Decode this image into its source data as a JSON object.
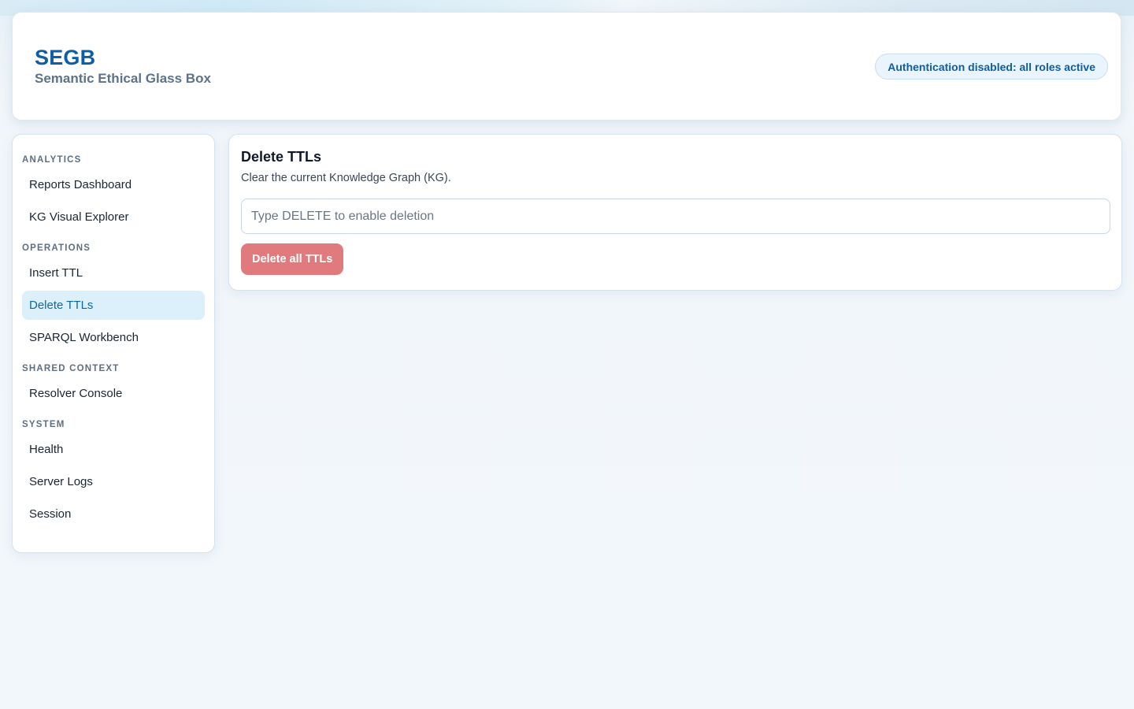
{
  "header": {
    "title": "SEGB",
    "subtitle": "Semantic Ethical Glass Box",
    "auth_badge": "Authentication disabled: all roles active"
  },
  "sidebar": {
    "sections": [
      {
        "title": "ANALYTICS",
        "items": [
          {
            "label": "Reports Dashboard"
          },
          {
            "label": "KG Visual Explorer"
          }
        ]
      },
      {
        "title": "OPERATIONS",
        "items": [
          {
            "label": "Insert TTL"
          },
          {
            "label": "Delete TTLs",
            "active": true
          },
          {
            "label": "SPARQL Workbench"
          }
        ]
      },
      {
        "title": "SHARED CONTEXT",
        "items": [
          {
            "label": "Resolver Console"
          }
        ]
      },
      {
        "title": "SYSTEM",
        "items": [
          {
            "label": "Health"
          },
          {
            "label": "Server Logs"
          },
          {
            "label": "Session"
          }
        ]
      }
    ]
  },
  "main": {
    "title": "Delete TTLs",
    "description": "Clear the current Knowledge Graph (KG).",
    "confirm_input": {
      "value": "",
      "placeholder": "Type DELETE to enable deletion"
    },
    "delete_button_label": "Delete all TTLs"
  },
  "colors": {
    "brand": "#0d5ea6",
    "active_nav_bg": "#dcf0fb",
    "danger_disabled": "#e07a7c"
  }
}
